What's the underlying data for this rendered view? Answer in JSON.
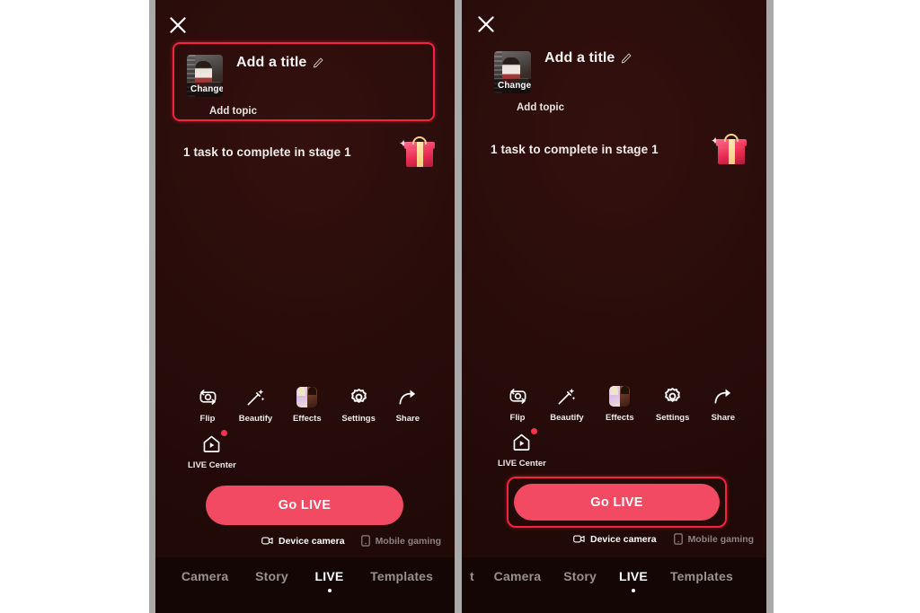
{
  "app": {
    "screen_name": "TikTok LIVE go-live setup",
    "background_color": "#2a0d0b",
    "accent_color": "#f24a63",
    "highlight_color": "#f5233f"
  },
  "panels": [
    {
      "id": "panel-left",
      "highlight_target": "title-card",
      "close_label": "close-icon",
      "title_card": {
        "thumbnail_overlay_label": "Change",
        "title_placeholder": "Add a title",
        "edit_icon": "pencil-icon",
        "topic_label": "Add topic",
        "topic_icon": "smiley-emoji"
      },
      "task_banner": {
        "text": "1 task to complete in stage 1",
        "icon": "gift-icon"
      },
      "tools": [
        {
          "label": "Flip",
          "icon": "flip-camera-icon",
          "badge": false
        },
        {
          "label": "Beautify",
          "icon": "magic-wand-icon",
          "badge": false
        },
        {
          "label": "Effects",
          "icon": "effects-face-icon",
          "badge": false
        },
        {
          "label": "Settings",
          "icon": "gear-icon",
          "badge": false
        },
        {
          "label": "Share",
          "icon": "share-arrow-icon",
          "badge": false
        }
      ],
      "live_center": {
        "label": "LIVE Center",
        "icon": "live-center-house-icon",
        "badge": true
      },
      "go_live": {
        "label": "Go LIVE"
      },
      "modes": [
        {
          "label": "Device camera",
          "icon": "camera-box-icon",
          "state": "active"
        },
        {
          "label": "Mobile gaming",
          "icon": "phone-icon",
          "state": "dim"
        },
        {
          "label": "",
          "icon": "video-camera-icon",
          "state": "dim"
        }
      ],
      "bottom_nav": {
        "cut_label": "",
        "items": [
          {
            "label": "Camera",
            "active": false
          },
          {
            "label": "Story",
            "active": false
          },
          {
            "label": "LIVE",
            "active": true
          },
          {
            "label": "Templates",
            "active": false
          }
        ]
      }
    },
    {
      "id": "panel-right",
      "highlight_target": "go-live-button",
      "close_label": "close-icon",
      "title_card": {
        "thumbnail_overlay_label": "Change",
        "title_placeholder": "Add a title",
        "edit_icon": "pencil-icon",
        "topic_label": "Add topic",
        "topic_icon": "smiley-emoji"
      },
      "task_banner": {
        "text": "1 task to complete in stage 1",
        "icon": "gift-icon"
      },
      "tools": [
        {
          "label": "Flip",
          "icon": "flip-camera-icon",
          "badge": false
        },
        {
          "label": "Beautify",
          "icon": "magic-wand-icon",
          "badge": false
        },
        {
          "label": "Effects",
          "icon": "effects-face-icon",
          "badge": false
        },
        {
          "label": "Settings",
          "icon": "gear-icon",
          "badge": false
        },
        {
          "label": "Share",
          "icon": "share-arrow-icon",
          "badge": false
        }
      ],
      "live_center": {
        "label": "LIVE Center",
        "icon": "live-center-house-icon",
        "badge": true
      },
      "go_live": {
        "label": "Go LIVE"
      },
      "modes": [
        {
          "label": "Device camera",
          "icon": "camera-box-icon",
          "state": "active"
        },
        {
          "label": "Mobile gaming",
          "icon": "phone-icon",
          "state": "dim"
        },
        {
          "label": "",
          "icon": "video-camera-icon",
          "state": "dim"
        }
      ],
      "bottom_nav": {
        "cut_label": "t",
        "items": [
          {
            "label": "Camera",
            "active": false
          },
          {
            "label": "Story",
            "active": false
          },
          {
            "label": "LIVE",
            "active": true
          },
          {
            "label": "Templates",
            "active": false
          }
        ]
      }
    }
  ]
}
